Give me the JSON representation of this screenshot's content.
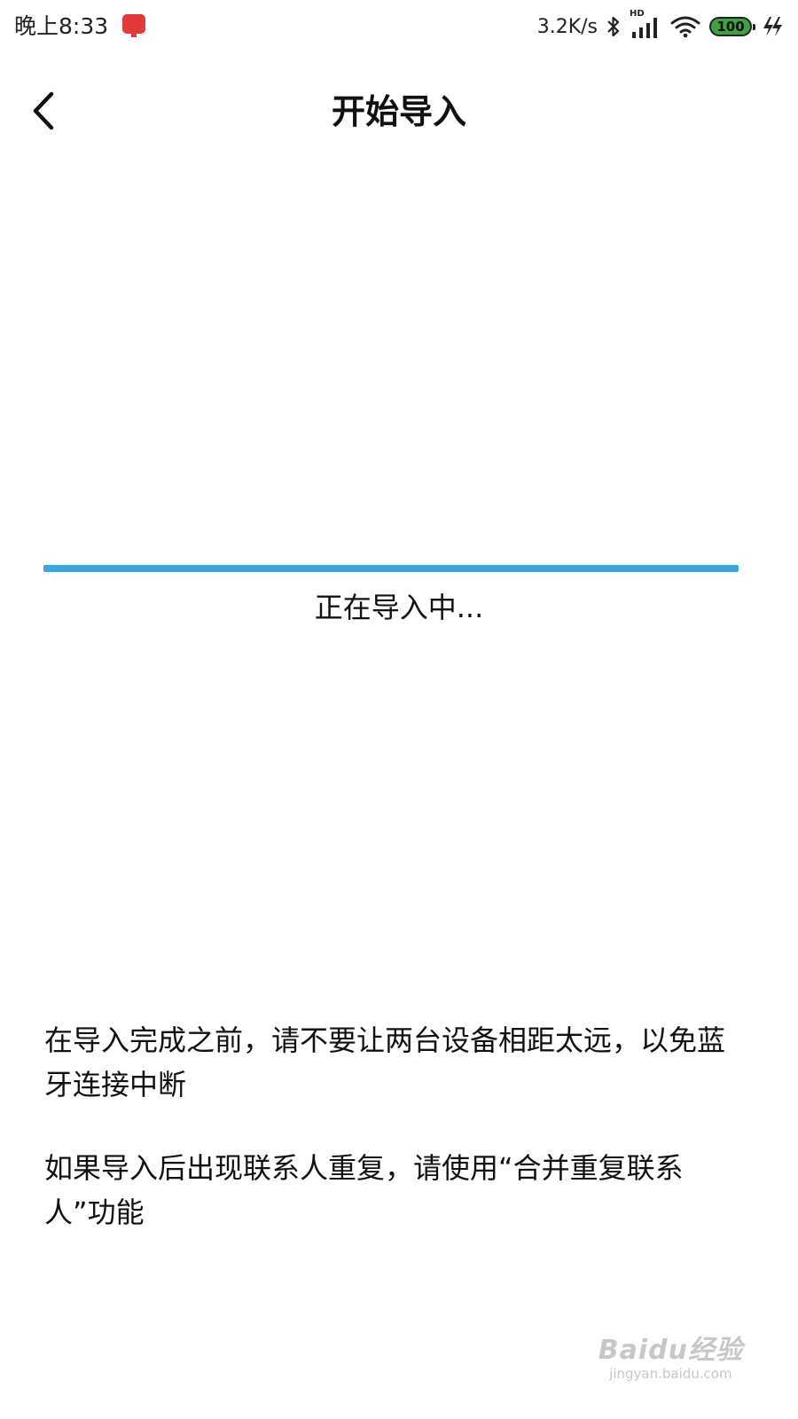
{
  "status_bar": {
    "time": "晚上8:33",
    "network_speed": "3.2K/s",
    "signal_label": "HD",
    "battery_level": "100",
    "icons": [
      "app-notification-icon",
      "bluetooth-icon",
      "cellular-signal-icon",
      "wifi-icon",
      "battery-icon",
      "charging-icon"
    ]
  },
  "header": {
    "title": "开始导入",
    "back_icon": "chevron-left-icon"
  },
  "progress": {
    "fill_fraction": 1.0,
    "status_text": "正在导入中...",
    "color": "#3aa6df"
  },
  "notes": [
    "在导入完成之前，请不要让两台设备相距太远，以免蓝牙连接中断",
    "如果导入后出现联系人重复，请使用“合并重复联系人”功能"
  ],
  "watermark": {
    "logo_text": "Baidu经验",
    "url": "jingyan.baidu.com"
  }
}
